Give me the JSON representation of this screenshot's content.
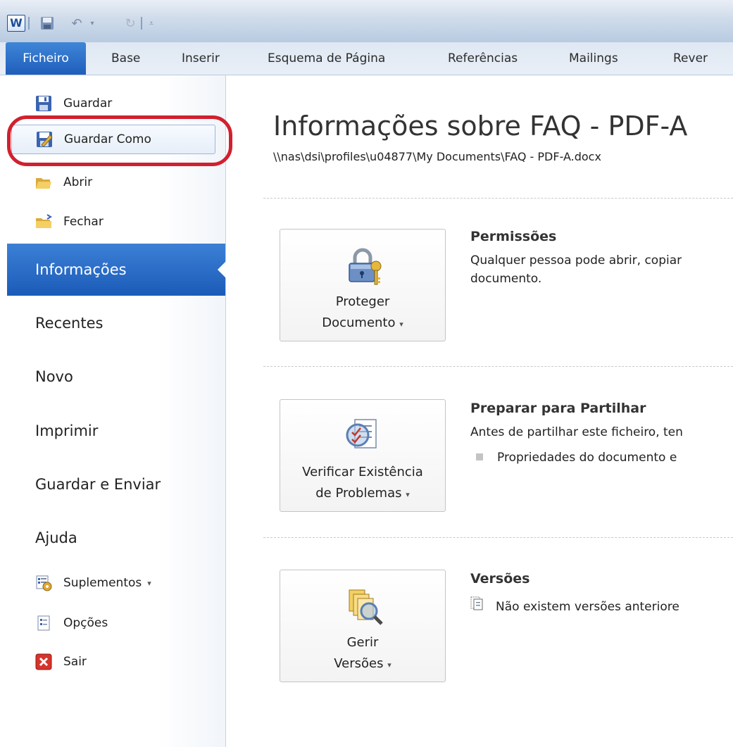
{
  "app": {
    "logo_letter": "W"
  },
  "tabs": [
    "Ficheiro",
    "Base",
    "Inserir",
    "Esquema de Página",
    "Referências",
    "Mailings",
    "Rever"
  ],
  "left_commands": {
    "save": "Guardar",
    "save_as": "Guardar Como",
    "open": "Abrir",
    "close": "Fechar"
  },
  "nav": {
    "info": "Informações",
    "recent": "Recentes",
    "new": "Novo",
    "print": "Imprimir",
    "save_send": "Guardar e Enviar",
    "help": "Ajuda"
  },
  "bottom_commands": {
    "addins": "Suplementos",
    "options": "Opções",
    "exit": "Sair"
  },
  "main": {
    "title": "Informações sobre FAQ - PDF-A",
    "path": "\\\\nas\\dsi\\profiles\\u04877\\My Documents\\FAQ - PDF-A.docx",
    "permissions": {
      "button_line1": "Proteger",
      "button_line2": "Documento",
      "title": "Permissões",
      "text_line1": "Qualquer pessoa pode abrir, copiar",
      "text_line2": "documento."
    },
    "prepare": {
      "button_line1": "Verificar Existência",
      "button_line2": "de Problemas",
      "title": "Preparar para Partilhar",
      "text_line1": "Antes de partilhar este ficheiro, ten",
      "bullet": "Propriedades do documento e"
    },
    "versions": {
      "button_line1": "Gerir",
      "button_line2": "Versões",
      "title": "Versões",
      "text_line1": "Não existem versões anteriore"
    }
  },
  "colors": {
    "file_tab": "#2a6dc8",
    "selected_nav": "#2a6dc8",
    "highlight_ring": "#d1202f"
  },
  "icons": {
    "save": "floppy-disk-icon",
    "save_as": "save-as-icon",
    "open": "open-folder-icon",
    "close": "close-folder-icon",
    "protect": "padlock-key-icon",
    "inspect": "checklist-magnifier-icon",
    "versions": "documents-magnifier-icon",
    "addins": "addins-gear-icon",
    "options": "options-document-icon",
    "exit": "exit-x-icon"
  }
}
